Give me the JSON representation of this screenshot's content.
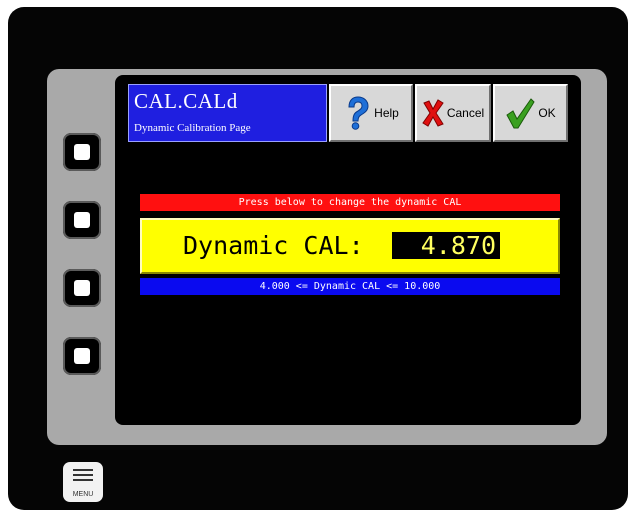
{
  "header": {
    "title": "CAL.CALd",
    "subtitle": "Dynamic Calibration Page"
  },
  "toolbar": {
    "help_label": "Help",
    "cancel_label": "Cancel",
    "ok_label": "OK"
  },
  "instruction": "Press below to change the dynamic CAL",
  "field": {
    "label": "Dynamic CAL:",
    "value": "4.870"
  },
  "range": "4.000 <= Dynamic CAL <= 10.000",
  "menu_key": {
    "label": "MENU"
  },
  "icons": {
    "help": "question-mark-icon",
    "cancel": "x-mark-icon",
    "ok": "checkmark-icon",
    "menu": "menu-lines-icon"
  },
  "colors": {
    "title_bg": "#1f1fe0",
    "instruction_bg": "#ff1010",
    "field_bg": "#ffff00",
    "range_bg": "#0a0af0"
  }
}
